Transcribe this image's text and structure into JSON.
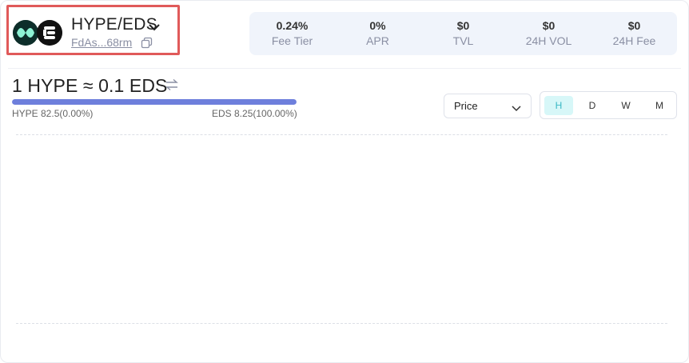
{
  "pair": {
    "title": "HYPE/EDS",
    "address": "FdAs...68rm",
    "token_a_logo": "hype-logo-icon",
    "token_b_logo": "eds-logo-icon"
  },
  "stats": [
    {
      "value": "0.24%",
      "label": "Fee Tier"
    },
    {
      "value": "0%",
      "label": "APR"
    },
    {
      "value": "$0",
      "label": "TVL"
    },
    {
      "value": "$0",
      "label": "24H VOL"
    },
    {
      "value": "$0",
      "label": "24H Fee"
    }
  ],
  "rate": {
    "text": "1 HYPE ≈ 0.1 EDS"
  },
  "ratio_bar": {
    "fill_fraction": 1.0,
    "left_label": "HYPE 82.5(0.00%)",
    "right_label": "EDS 8.25(100.00%)"
  },
  "chart_controls": {
    "select_value": "Price",
    "intervals": [
      "H",
      "D",
      "W",
      "M"
    ],
    "active_interval": "H"
  },
  "colors": {
    "highlight_border": "#e05a5a",
    "bar_fill": "#6e7fdc",
    "active_toggle_bg": "#d7f7f8",
    "active_toggle_text": "#39b8c4",
    "stats_bg": "#f0f4fb"
  }
}
